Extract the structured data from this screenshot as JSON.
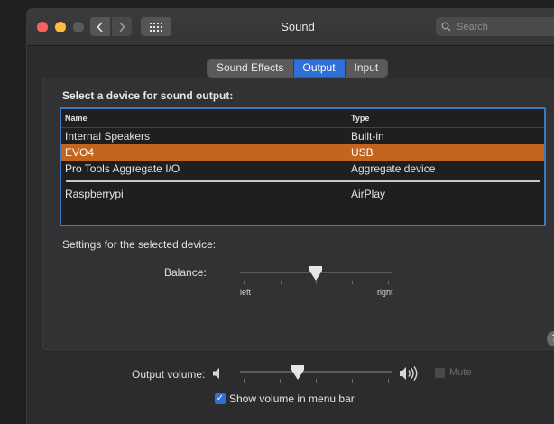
{
  "window": {
    "title": "Sound",
    "search_placeholder": "Search",
    "icons": {
      "back": "chevron-left-icon",
      "forward": "chevron-right-icon",
      "grid": "grid-icon"
    }
  },
  "tabs": [
    {
      "label": "Sound Effects",
      "active": false
    },
    {
      "label": "Output",
      "active": true
    },
    {
      "label": "Input",
      "active": false
    }
  ],
  "output": {
    "select_label": "Select a device for sound output:",
    "columns": {
      "name": "Name",
      "type": "Type"
    },
    "devices": [
      {
        "name": "Internal Speakers",
        "type": "Built-in",
        "selected": false
      },
      {
        "name": "EVO4",
        "type": "USB",
        "selected": true
      },
      {
        "name": "Pro Tools Aggregate I/O",
        "type": "Aggregate device",
        "selected": false
      },
      {
        "name": "Raspberrypi",
        "type": "AirPlay",
        "selected": false
      }
    ],
    "settings_label": "Settings for the selected device:",
    "balance": {
      "label": "Balance:",
      "left": "left",
      "right": "right",
      "value": 0.5
    },
    "help": "?"
  },
  "volume": {
    "label": "Output volume:",
    "value": 0.38,
    "mute_label": "Mute",
    "mute_checked": false,
    "show_in_menu_bar_label": "Show volume in menu bar",
    "show_in_menu_bar_checked": true
  },
  "colors": {
    "selection": "#c4651d",
    "accent": "#2f6fd7",
    "table_focus_border": "#3a79c6"
  }
}
